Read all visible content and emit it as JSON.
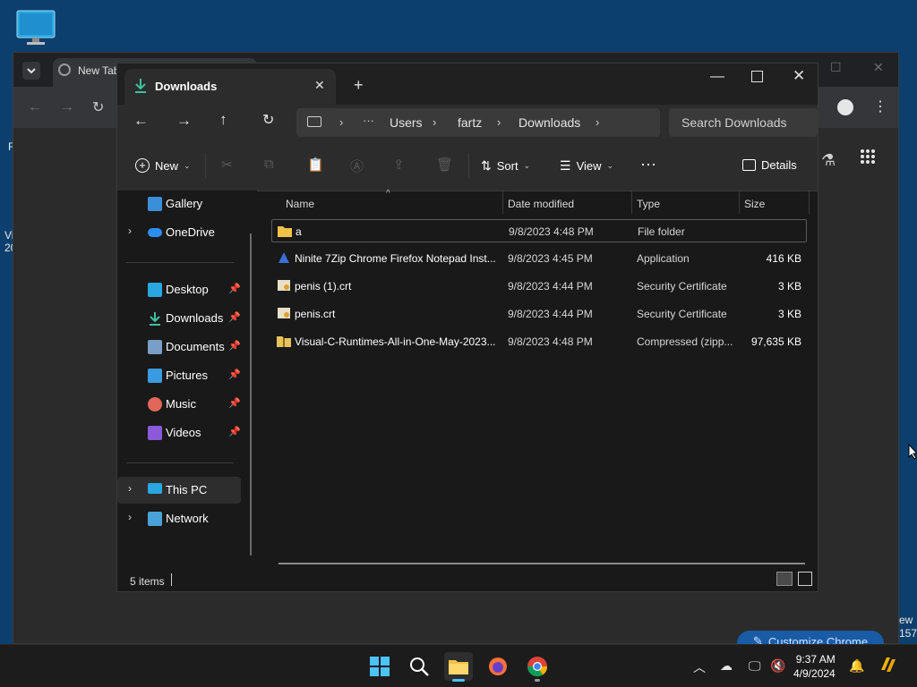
{
  "desktop": {
    "fragments": [
      "R",
      "Vi",
      "20",
      "ew",
      "157"
    ]
  },
  "chrome": {
    "tab_title": "New Tab",
    "customize_label": "Customize Chrome"
  },
  "explorer": {
    "tab_title": "Downloads",
    "breadcrumb": [
      "Users",
      "fartz",
      "Downloads"
    ],
    "search_placeholder": "Search Downloads",
    "commands": {
      "new": "New",
      "sort": "Sort",
      "view": "View",
      "details": "Details"
    },
    "nav": {
      "gallery": "Gallery",
      "onedrive": "OneDrive",
      "desktop": "Desktop",
      "downloads": "Downloads",
      "documents": "Documents",
      "pictures": "Pictures",
      "music": "Music",
      "videos": "Videos",
      "thispc": "This PC",
      "network": "Network"
    },
    "columns": {
      "name": "Name",
      "date": "Date modified",
      "type": "Type",
      "size": "Size"
    },
    "files": [
      {
        "name": "a",
        "date": "9/8/2023 4:48 PM",
        "type": "File folder",
        "size": ""
      },
      {
        "name": "Ninite 7Zip Chrome Firefox Notepad Inst...",
        "date": "9/8/2023 4:45 PM",
        "type": "Application",
        "size": "416 KB"
      },
      {
        "name": "penis (1).crt",
        "date": "9/8/2023 4:44 PM",
        "type": "Security Certificate",
        "size": "3 KB"
      },
      {
        "name": "penis.crt",
        "date": "9/8/2023 4:44 PM",
        "type": "Security Certificate",
        "size": "3 KB"
      },
      {
        "name": "Visual-C-Runtimes-All-in-One-May-2023...",
        "date": "9/8/2023 4:48 PM",
        "type": "Compressed (zipp...",
        "size": "97,635 KB"
      }
    ],
    "status": "5 items"
  },
  "taskbar": {
    "time": "9:37 AM",
    "date": "4/9/2024"
  }
}
